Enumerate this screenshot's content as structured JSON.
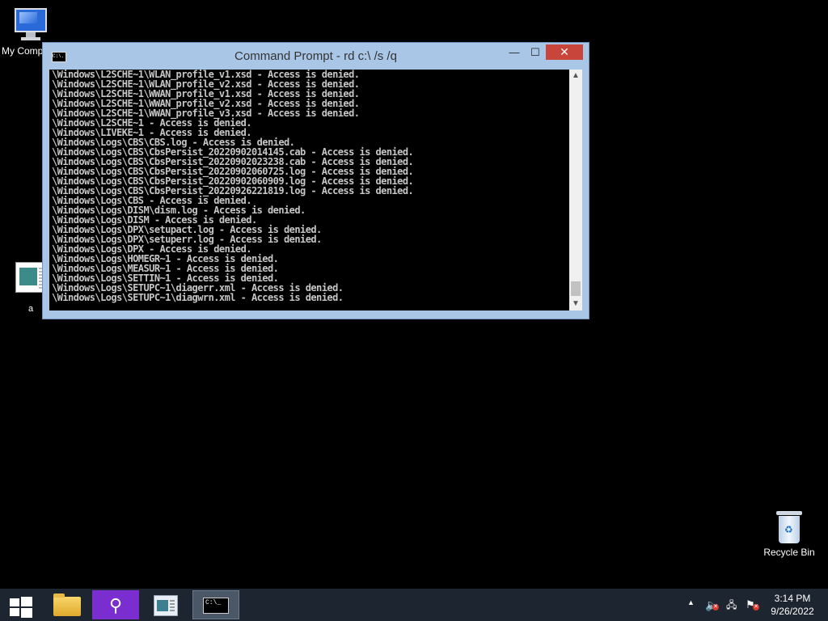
{
  "desktop": {
    "my_computer_label": "My Comp",
    "file_label": "a",
    "recycle_bin_label": "Recycle Bin"
  },
  "window": {
    "title": "Command Prompt - rd  c:\\ /s /q",
    "title_icon_text": "C:\\.",
    "minimize_glyph": "—",
    "maximize_glyph": "☐",
    "close_glyph": "✕",
    "console_lines": [
      "\\Windows\\L2SCHE~1\\WLAN_profile_v1.xsd - Access is denied.",
      "\\Windows\\L2SCHE~1\\WLAN_profile_v2.xsd - Access is denied.",
      "\\Windows\\L2SCHE~1\\WWAN_profile_v1.xsd - Access is denied.",
      "\\Windows\\L2SCHE~1\\WWAN_profile_v2.xsd - Access is denied.",
      "\\Windows\\L2SCHE~1\\WWAN_profile_v3.xsd - Access is denied.",
      "\\Windows\\L2SCHE~1 - Access is denied.",
      "\\Windows\\LIVEKE~1 - Access is denied.",
      "\\Windows\\Logs\\CBS\\CBS.log - Access is denied.",
      "\\Windows\\Logs\\CBS\\CbsPersist_20220902014145.cab - Access is denied.",
      "\\Windows\\Logs\\CBS\\CbsPersist_20220902023238.cab - Access is denied.",
      "\\Windows\\Logs\\CBS\\CbsPersist_20220902060725.log - Access is denied.",
      "\\Windows\\Logs\\CBS\\CbsPersist_20220902060909.log - Access is denied.",
      "\\Windows\\Logs\\CBS\\CbsPersist_20220926221819.log - Access is denied.",
      "\\Windows\\Logs\\CBS - Access is denied.",
      "\\Windows\\Logs\\DISM\\dism.log - Access is denied.",
      "\\Windows\\Logs\\DISM - Access is denied.",
      "\\Windows\\Logs\\DPX\\setupact.log - Access is denied.",
      "\\Windows\\Logs\\DPX\\setuperr.log - Access is denied.",
      "\\Windows\\Logs\\DPX - Access is denied.",
      "\\Windows\\Logs\\HOMEGR~1 - Access is denied.",
      "\\Windows\\Logs\\MEASUR~1 - Access is denied.",
      "\\Windows\\Logs\\SETTIN~1 - Access is denied.",
      "\\Windows\\Logs\\SETUPC~1\\diagerr.xml - Access is denied.",
      "\\Windows\\Logs\\SETUPC~1\\diagwrn.xml - Access is denied."
    ]
  },
  "taskbar": {
    "tray": {
      "time": "3:14 PM",
      "date": "9/26/2022"
    },
    "cmd_icon_text": "C:\\_"
  },
  "colors": {
    "console_text": "#c6c6c6",
    "window_frame": "#a9c6e6",
    "close_button": "#c7453a",
    "taskbar": "#1d2630"
  }
}
